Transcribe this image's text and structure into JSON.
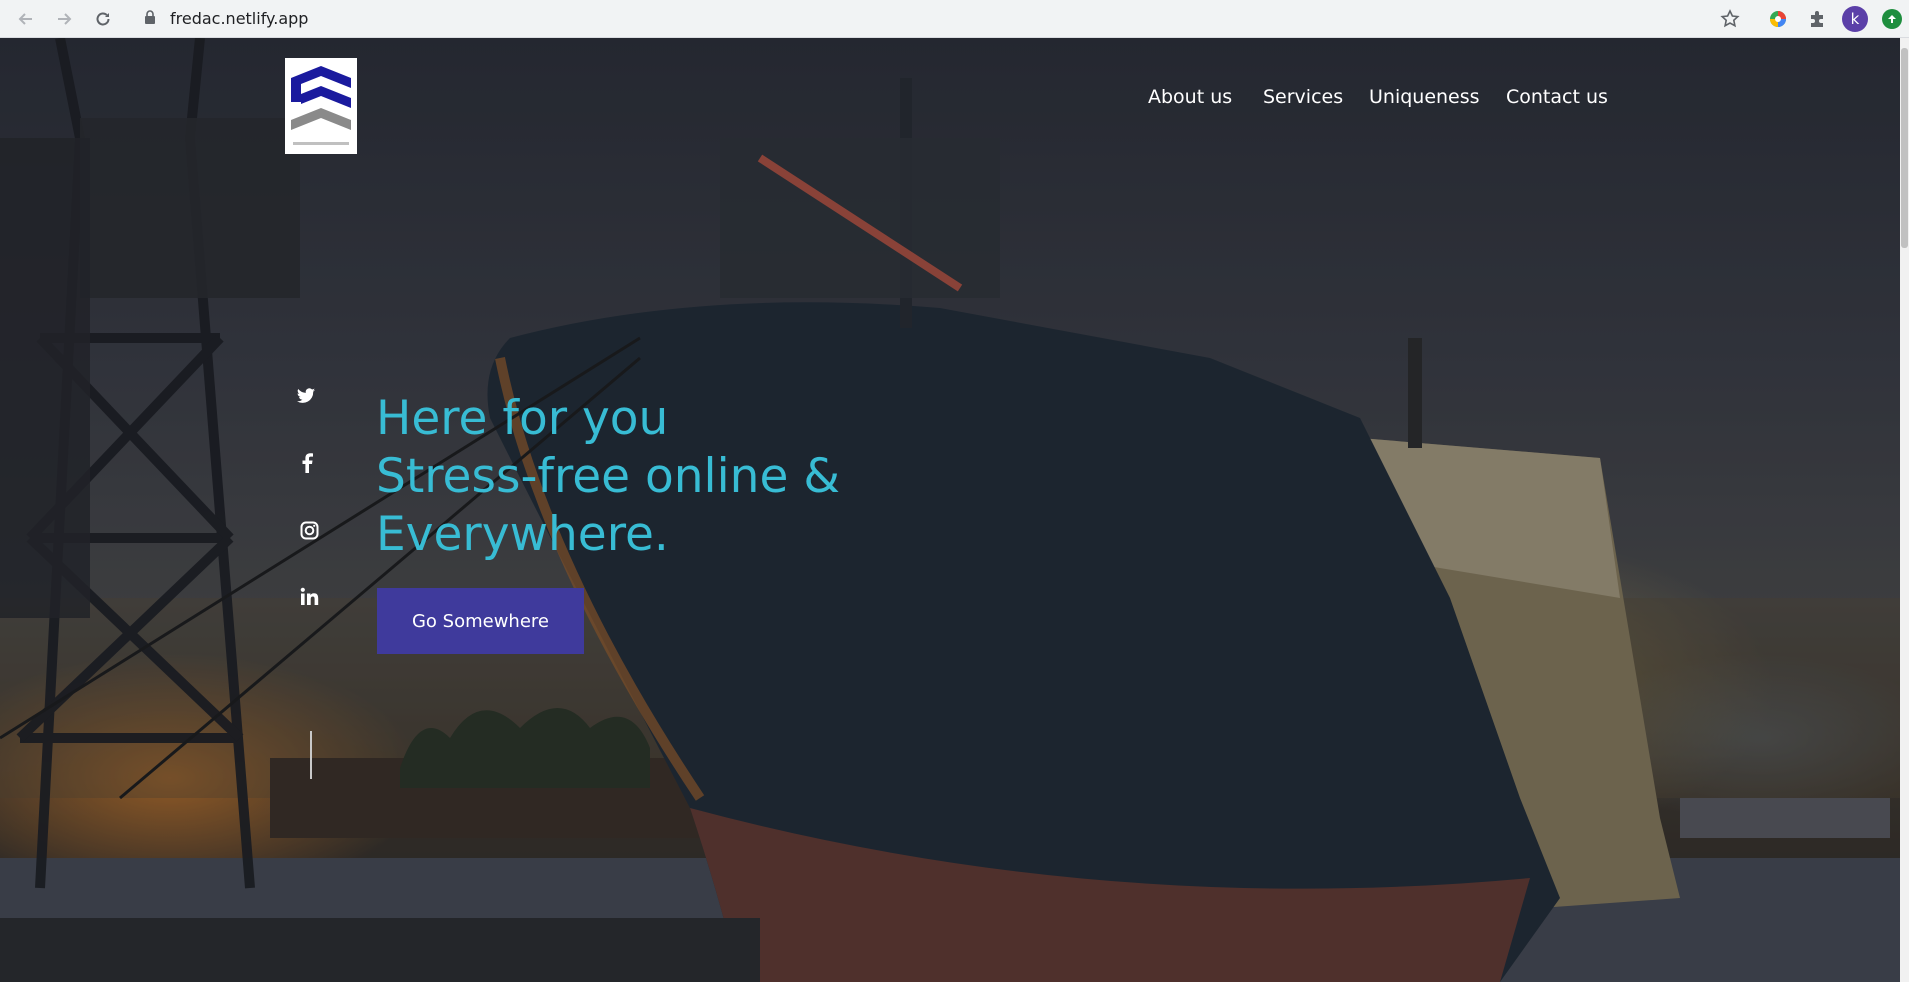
{
  "browser": {
    "url": "fredac.netlify.app",
    "profile_initial": "k",
    "icons": [
      "back-icon",
      "forward-icon",
      "reload-icon",
      "lock-icon",
      "star-icon",
      "color-wheel-icon",
      "extensions-icon",
      "update-icon"
    ]
  },
  "nav": {
    "items": [
      {
        "label": "About us"
      },
      {
        "label": "Services"
      },
      {
        "label": "Uniqueness"
      },
      {
        "label": "Contact us"
      }
    ]
  },
  "social": {
    "icons": [
      "twitter-icon",
      "facebook-icon",
      "instagram-icon",
      "linkedin-icon"
    ]
  },
  "hero": {
    "line1": "Here for you",
    "line2": "Stress-free online &",
    "line3": "Everywhere.",
    "cta_label": "Go Somewhere"
  },
  "colors": {
    "headline": "#38bcd4",
    "cta_background": "#3f3a9c",
    "logo_blue": "#1a1a9e",
    "logo_gray": "#8a8a8a"
  }
}
